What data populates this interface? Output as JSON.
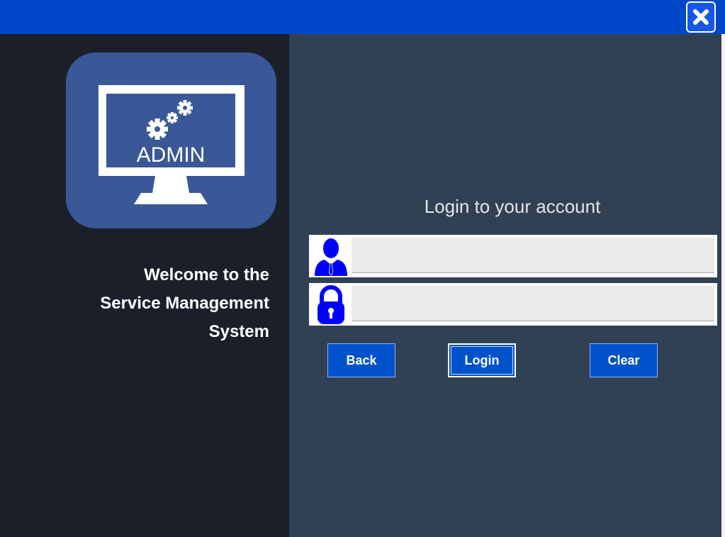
{
  "window": {
    "close_icon": "close-icon",
    "titlebar_color": "#0047c9"
  },
  "logo": {
    "text": "ADMIN",
    "icon": "admin-monitor-gears-icon",
    "bg_color": "#3a5898"
  },
  "welcome": {
    "lines": [
      "Welcome to the",
      "Service Management",
      "System"
    ]
  },
  "login": {
    "title": "Login to your account",
    "username": {
      "icon": "user-icon",
      "value": "",
      "placeholder": ""
    },
    "password": {
      "icon": "lock-icon",
      "value": "",
      "placeholder": ""
    }
  },
  "buttons": {
    "back": "Back",
    "login": "Login",
    "clear": "Clear"
  },
  "colors": {
    "left_panel": "#1b1f2a",
    "right_panel": "#314154",
    "button": "#0052cc",
    "icon_blue": "#0000ff"
  }
}
